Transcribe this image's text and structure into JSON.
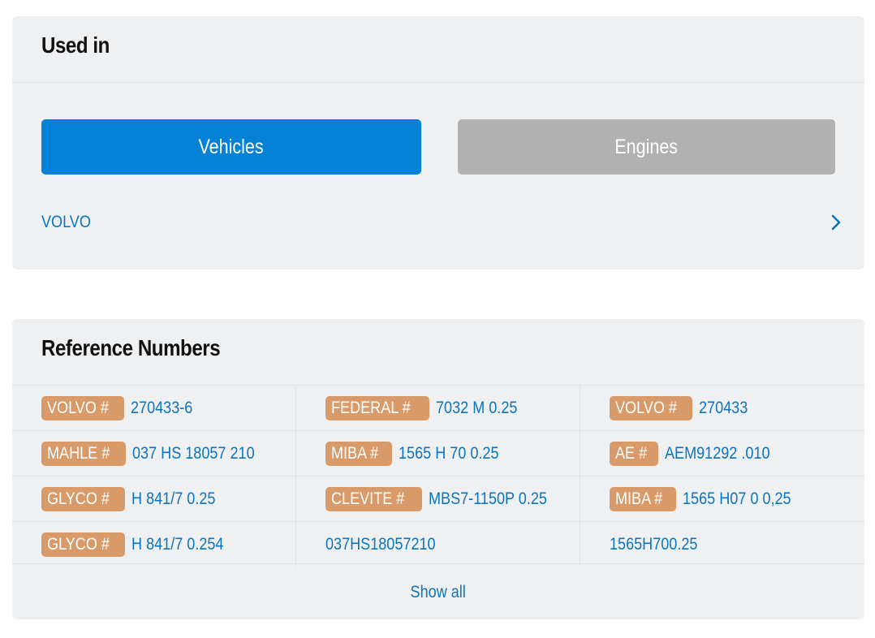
{
  "used_in": {
    "title": "Used in",
    "tabs": {
      "vehicles": "Vehicles",
      "engines": "Engines"
    },
    "vehicles": [
      {
        "name": "VOLVO"
      }
    ]
  },
  "reference_numbers": {
    "title": "Reference Numbers",
    "rows": [
      [
        {
          "badge": "VOLVO #",
          "number": "270433-6"
        },
        {
          "badge": "FEDERAL #",
          "number": "7032 M 0.25"
        },
        {
          "badge": "VOLVO #",
          "number": "270433"
        }
      ],
      [
        {
          "badge": "MAHLE #",
          "number": "037 HS 18057 210"
        },
        {
          "badge": "MIBA #",
          "number": "1565 H 70 0.25"
        },
        {
          "badge": "AE #",
          "number": "AEM91292 .010"
        }
      ],
      [
        {
          "badge": "GLYCO #",
          "number": "H 841/7 0.25"
        },
        {
          "badge": "CLEVITE #",
          "number": "MBS7-1150P 0.25"
        },
        {
          "badge": "MIBA #",
          "number": "1565 H07 0 0,25"
        }
      ],
      [
        {
          "badge": "GLYCO #",
          "number": "H 841/7 0.254"
        },
        {
          "badge": "",
          "number": "037HS18057210"
        },
        {
          "badge": "",
          "number": "1565H700.25"
        }
      ]
    ],
    "show_all_label": "Show all"
  },
  "colors": {
    "accent": "#0582d8",
    "link": "#0b74bf",
    "badge": "#d79a68",
    "inactive_tab": "#b1b1b1",
    "card_bg": "#eff0f2"
  },
  "icons": {
    "vehicle_row": "chevron-right-icon"
  }
}
